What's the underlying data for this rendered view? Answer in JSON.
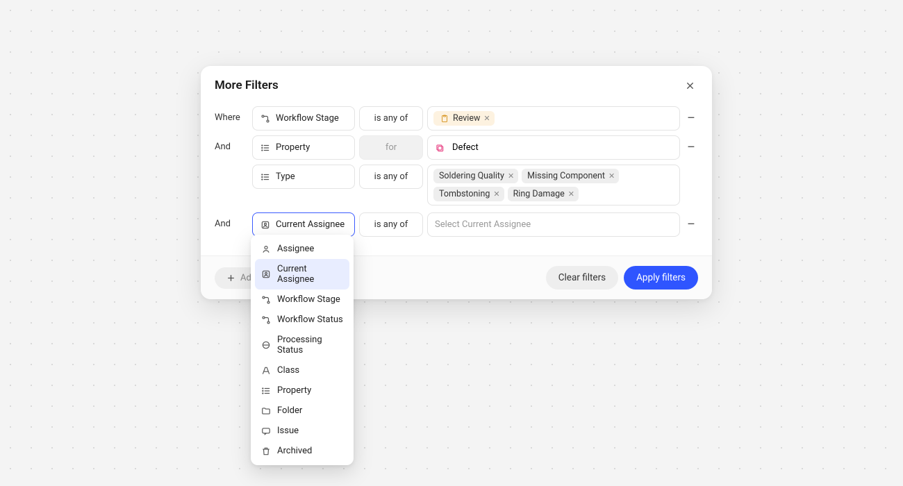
{
  "modal": {
    "title": "More Filters",
    "rows": [
      {
        "label": "Where",
        "field": "Workflow Stage",
        "op": "is any of",
        "chips": [
          "Review"
        ]
      },
      {
        "label": "And",
        "field": "Property",
        "op": "for",
        "op_disabled": true,
        "value_single": "Defect"
      },
      {
        "label": "",
        "field": "Type",
        "op": "is any of",
        "chips": [
          "Soldering Quality",
          "Missing Component",
          "Tombstoning",
          "Ring Damage"
        ]
      },
      {
        "label": "And",
        "field": "Current Assignee",
        "field_active": true,
        "op": "is any of",
        "placeholder": "Select Current Assignee"
      }
    ],
    "add_filter_label": "Add",
    "clear_label": "Clear filters",
    "apply_label": "Apply filters"
  },
  "dropdown": {
    "items": [
      {
        "icon": "user",
        "label": "Assignee"
      },
      {
        "icon": "user-badge",
        "label": "Current Assignee",
        "selected": true
      },
      {
        "icon": "workflow",
        "label": "Workflow Stage"
      },
      {
        "icon": "workflow",
        "label": "Workflow Status"
      },
      {
        "icon": "processing",
        "label": "Processing Status"
      },
      {
        "icon": "class",
        "label": "Class"
      },
      {
        "icon": "list",
        "label": "Property"
      },
      {
        "icon": "folder",
        "label": "Folder"
      },
      {
        "icon": "issue",
        "label": "Issue"
      },
      {
        "icon": "trash",
        "label": "Archived"
      }
    ]
  }
}
